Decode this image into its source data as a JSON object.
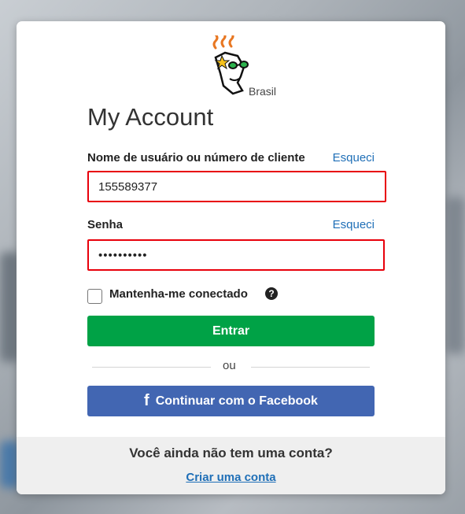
{
  "logo": {
    "name": "godaddy-guy-logo",
    "country": "Brasil"
  },
  "title": "My Account",
  "username": {
    "label": "Nome de usuário ou número de cliente",
    "forgot_link": "Esqueci",
    "value": "155589377"
  },
  "password": {
    "label": "Senha",
    "forgot_link": "Esqueci",
    "value": "••••••••••"
  },
  "remember": {
    "label": "Mantenha-me conectado",
    "checked": false,
    "help_icon": "?"
  },
  "buttons": {
    "enter": "Entrar",
    "divider": "ou",
    "facebook_icon": "f",
    "facebook": "Continuar com o Facebook"
  },
  "footer": {
    "question": "Você ainda não tem uma conta?",
    "create_link": "Criar uma conta"
  },
  "colors": {
    "accent_link": "#1f6fb7",
    "enter_button": "#00a246",
    "facebook_button": "#4266b2",
    "error_border": "#e8000b"
  }
}
